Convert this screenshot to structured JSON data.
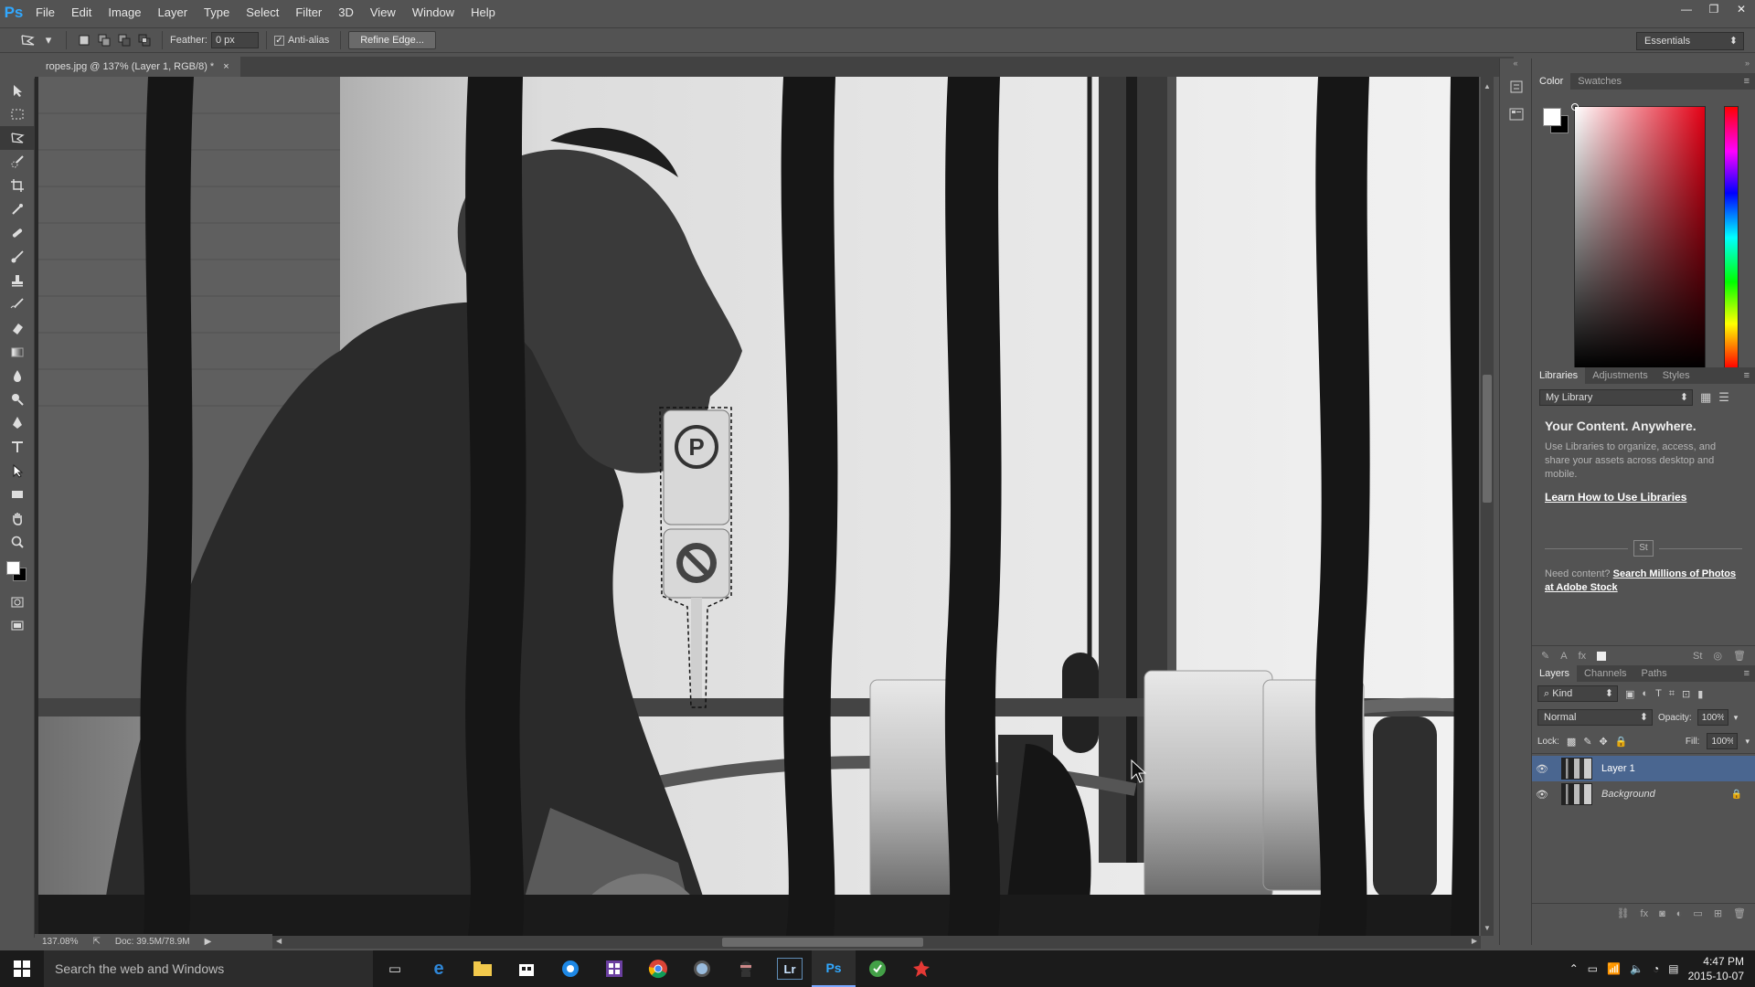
{
  "app": {
    "logo": "Ps",
    "menu": [
      "File",
      "Edit",
      "Image",
      "Layer",
      "Type",
      "Select",
      "Filter",
      "3D",
      "View",
      "Window",
      "Help"
    ],
    "window_controls": [
      "—",
      "❐",
      "✕"
    ]
  },
  "options_bar": {
    "feather_label": "Feather:",
    "feather_value": "0 px",
    "antialias_label": "Anti-alias",
    "antialias_checked": "✓",
    "refine_edge_label": "Refine Edge...",
    "workspace": "Essentials"
  },
  "document": {
    "tab_title": "ropes.jpg @ 137% (Layer 1, RGB/8) *",
    "tab_close": "×",
    "zoom": "137.08%",
    "doc_size": "Doc: 39.5M/78.9M"
  },
  "tools": [
    "move-tool",
    "marquee-tool",
    "polygonal-lasso-tool",
    "quick-selection-tool",
    "crop-tool",
    "eyedropper-tool",
    "spot-healing-tool",
    "brush-tool",
    "clone-stamp-tool",
    "history-brush-tool",
    "eraser-tool",
    "gradient-tool",
    "blur-tool",
    "dodge-tool",
    "pen-tool",
    "type-tool",
    "path-selection-tool",
    "rectangle-tool",
    "hand-tool",
    "zoom-tool"
  ],
  "color_panel": {
    "tabs": [
      "Color",
      "Swatches"
    ],
    "fg_color": "#ffffff",
    "bg_color": "#000000"
  },
  "libraries_panel": {
    "tabs": [
      "Libraries",
      "Adjustments",
      "Styles"
    ],
    "library_select": "My Library",
    "headline": "Your Content. Anywhere.",
    "description": "Use Libraries to organize, access, and share your assets across desktop and mobile.",
    "learn_link": "Learn How to Use Libraries",
    "stock_badge": "St",
    "need_content": "Need content?",
    "stock_link": "Search Millions of Photos at Adobe Stock"
  },
  "layers_panel": {
    "tabs": [
      "Layers",
      "Channels",
      "Paths"
    ],
    "kind_filter": "Kind",
    "blend_mode": "Normal",
    "opacity_label": "Opacity:",
    "opacity_value": "100%",
    "lock_label": "Lock:",
    "fill_label": "Fill:",
    "fill_value": "100%",
    "layers": [
      {
        "name": "Layer 1",
        "selected": true
      },
      {
        "name": "Background",
        "selected": false
      }
    ]
  },
  "taskbar": {
    "search_placeholder": "Search the web and Windows",
    "apps": [
      "task-view",
      "edge",
      "file-explorer",
      "store",
      "app-blue",
      "app-grid",
      "chrome",
      "app-globe",
      "app-ninja",
      "lightroom",
      "photoshop",
      "app-green",
      "app-red"
    ],
    "lightroom_label": "Lr",
    "photoshop_label": "Ps",
    "time": "4:47 PM",
    "date": "2015-10-07"
  }
}
